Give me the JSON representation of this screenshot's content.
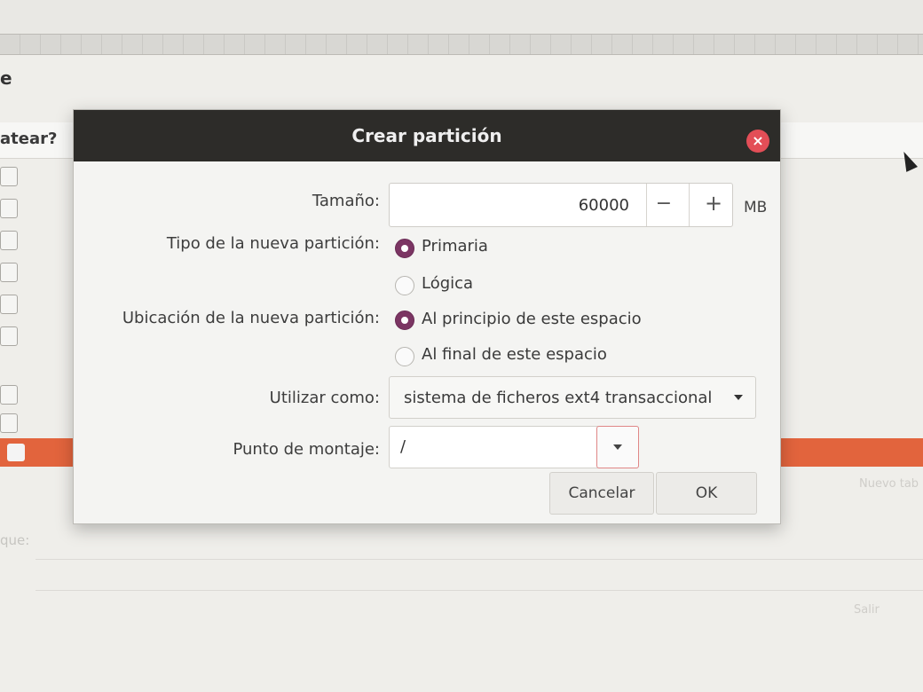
{
  "background": {
    "title_fragment": "e",
    "header_fragment": "atear?",
    "faded_label": "que:",
    "faded_button_1": "Nuevo tab",
    "faded_button_2": "Salir"
  },
  "dialog": {
    "title": "Crear partición",
    "size": {
      "label": "Tamaño:",
      "value": "60000",
      "minus": "−",
      "plus": "+",
      "unit": "MB"
    },
    "type": {
      "label": "Tipo de la nueva partición:",
      "options": [
        "Primaria",
        "Lógica"
      ],
      "selected": "Primaria"
    },
    "location": {
      "label": "Ubicación de la nueva partición:",
      "options": [
        "Al principio de este espacio",
        "Al final de este espacio"
      ],
      "selected": "Al principio de este espacio"
    },
    "use_as": {
      "label": "Utilizar como:",
      "value": "sistema de ficheros ext4 transaccional"
    },
    "mount_point": {
      "label": "Punto de montaje:",
      "value": "/"
    },
    "buttons": {
      "cancel": "Cancelar",
      "ok": "OK"
    }
  },
  "colors": {
    "accent": "#7b3563",
    "selection": "#e2643d",
    "titlebar": "#2d2c29",
    "close": "#e34e57"
  }
}
